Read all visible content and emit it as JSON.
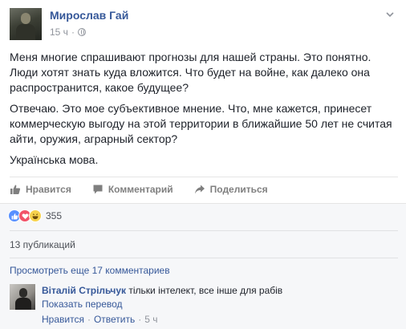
{
  "post": {
    "author": "Мирослав Гай",
    "time": "15 ч",
    "separator": "·",
    "paragraphs": [
      "Меня многие спрашивают прогнозы для нашей страны. Это понятно. Люди хотят знать куда вложится. Что будет на войне, как далеко она распространится, какое будущее?",
      "Отвечаю. Это мое субъективное мнение. Что, мне кажется, принесет коммерческую выгоду на этой территории в ближайшие 50 лет не считая айти, оружия, аграрный сектор?",
      "Українська мова."
    ]
  },
  "actions": {
    "like": "Нравится",
    "comment": "Комментарий",
    "share": "Поделиться"
  },
  "reactions": {
    "count": "355",
    "types": [
      "like",
      "love",
      "haha"
    ]
  },
  "shares": "13 публикаций",
  "comments": {
    "view_more": "Просмотреть еще 17 комментариев",
    "items": [
      {
        "author": "Віталій Стрільчук",
        "text": "тільки інтелект, все інше для рабів",
        "translate": "Показать перевод",
        "like": "Нравится",
        "reply": "Ответить",
        "time": "5 ч"
      }
    ]
  },
  "colors": {
    "link": "#365899",
    "like": "#5890ff",
    "love": "#f25268",
    "haha": "#f7d24d"
  }
}
